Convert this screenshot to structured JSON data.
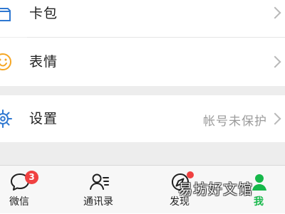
{
  "menu": {
    "card_package": {
      "label": "卡包",
      "icon": "wallet-icon"
    },
    "emoji": {
      "label": "表情",
      "icon": "smiley-icon"
    },
    "settings": {
      "label": "设置",
      "value": "帐号未保护",
      "icon": "gear-icon"
    }
  },
  "tabs": [
    {
      "label": "微信",
      "badge": "3",
      "icon": "chat-icon"
    },
    {
      "label": "通讯录",
      "icon": "contacts-icon"
    },
    {
      "label": "发现",
      "icon": "compass-icon"
    },
    {
      "label": "我",
      "icon": "profile-icon",
      "active": true
    }
  ],
  "watermark": "易坊好文馆",
  "colors": {
    "accent": "#16b84a",
    "badge": "#f04141",
    "icon_blue": "#2f78d1",
    "emoji_orange": "#f5a623"
  }
}
